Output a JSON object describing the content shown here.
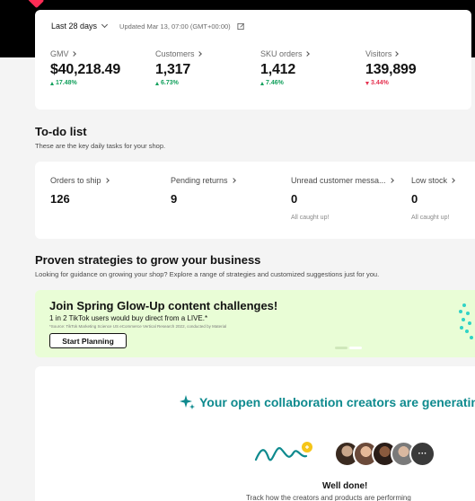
{
  "colors": {
    "positive": "#12a05c",
    "negative": "#e5304f",
    "accent_teal": "#0e8a8e",
    "banner_bg": "#e9fdd6"
  },
  "header": {
    "range_label": "Last 28 days",
    "updated_text": "Updated Mar 13, 07:00 (GMT+00:00)",
    "edit_icon": "edit-icon"
  },
  "metrics": [
    {
      "label": "GMV",
      "value": "$40,218.49",
      "delta": "17.48%",
      "direction": "up"
    },
    {
      "label": "Customers",
      "value": "1,317",
      "delta": "6.73%",
      "direction": "up"
    },
    {
      "label": "SKU orders",
      "value": "1,412",
      "delta": "7.46%",
      "direction": "up"
    },
    {
      "label": "Visitors",
      "value": "139,899",
      "delta": "3.44%",
      "direction": "down"
    }
  ],
  "todo": {
    "title": "To-do list",
    "subtitle": "These are the key daily tasks for your shop.",
    "items": [
      {
        "label": "Orders to ship",
        "value": "126",
        "note": ""
      },
      {
        "label": "Pending returns",
        "value": "9",
        "note": ""
      },
      {
        "label": "Unread customer messa...",
        "value": "0",
        "note": "All caught up!"
      },
      {
        "label": "Low stock",
        "value": "0",
        "note": "All caught up!"
      }
    ]
  },
  "strategies": {
    "title": "Proven strategies to grow your business",
    "subtitle": "Looking for guidance on growing your shop? Explore a range of strategies and customized suggestions just for you."
  },
  "banner": {
    "title": "Join Spring Glow-Up content challenges!",
    "subtitle": "1 in 2 TikTok users would buy direct from a LIVE.*",
    "fine_print": "*Source: TikTok Marketing Science US eCommerce Vertical Research 2022, conducted by Material",
    "button_label": "Start Planning",
    "slides_total": 2,
    "slide_active": 2
  },
  "collab": {
    "title": "Your open collaboration creators are generating",
    "sparkle_icon": "sparkle-icon",
    "more_label": "···",
    "done_title": "Well done!",
    "track_text": "Track how the creators and products are performing"
  }
}
